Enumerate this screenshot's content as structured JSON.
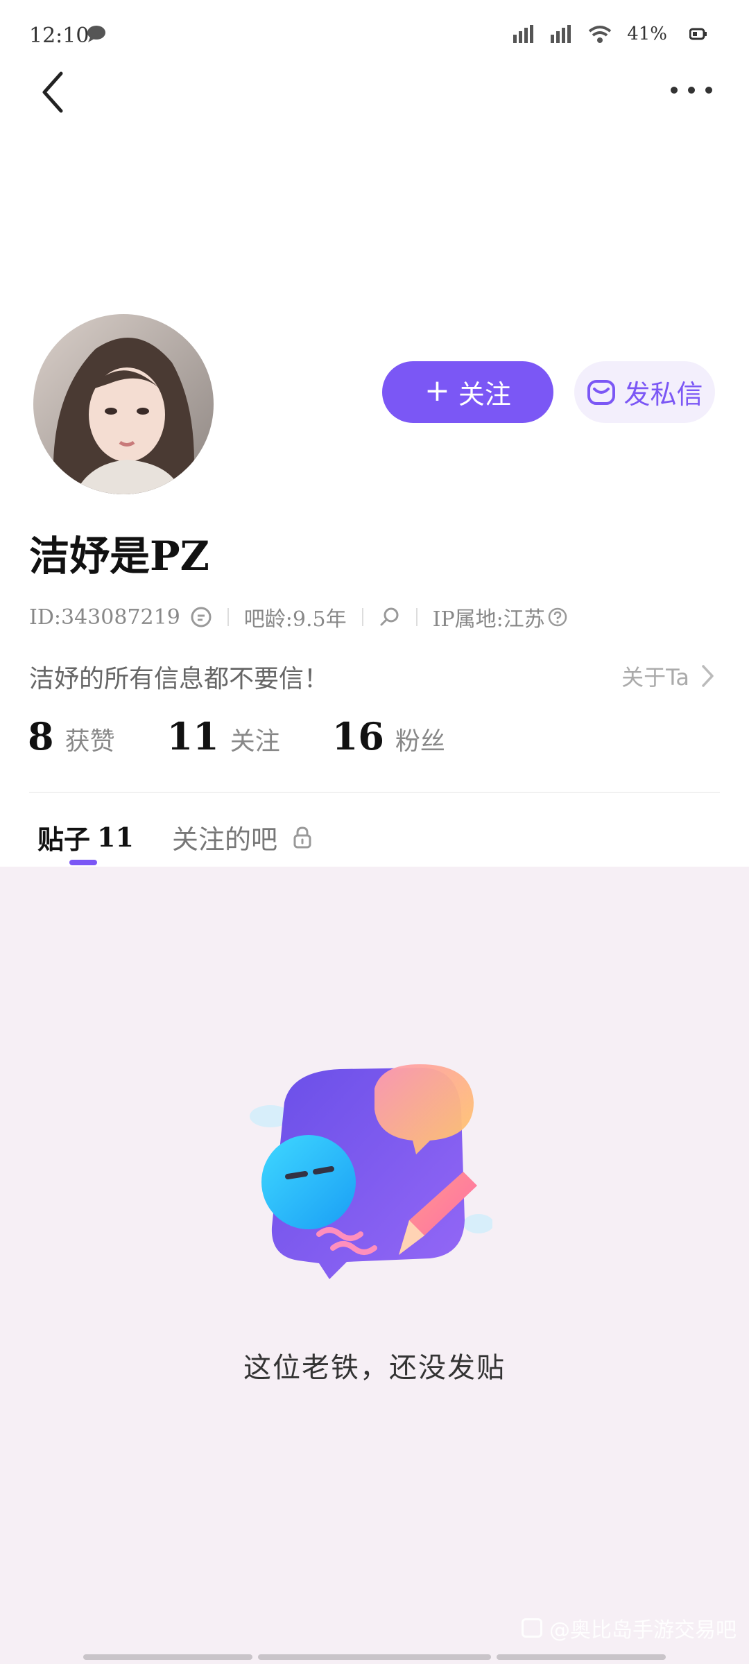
{
  "status_bar": {
    "time": "12:10",
    "battery_text": "41%"
  },
  "header": {
    "back_icon": "chevron-left-icon",
    "more_icon": "more-dots-icon"
  },
  "profile": {
    "username": "洁妤是PZ",
    "follow_label": "关注",
    "dm_label": "发私信",
    "id_text": "ID:343087219",
    "bar_age": "吧龄:9.5年",
    "ip_location": "IP属地:江苏",
    "bio": "洁妤的所有信息都不要信！",
    "about_label": "关于Ta"
  },
  "stats": [
    {
      "value": "8",
      "label": "获赞"
    },
    {
      "value": "11",
      "label": "关注"
    },
    {
      "value": "16",
      "label": "粉丝"
    }
  ],
  "tabs": {
    "posts_label": "贴子",
    "posts_count": "11",
    "follows_label": "关注的吧"
  },
  "empty_state": {
    "message": "这位老铁，还没发贴"
  },
  "watermark": "@奥比岛手游交易吧",
  "colors": {
    "accent": "#7b57f5",
    "content_bg": "#f6eff5"
  }
}
